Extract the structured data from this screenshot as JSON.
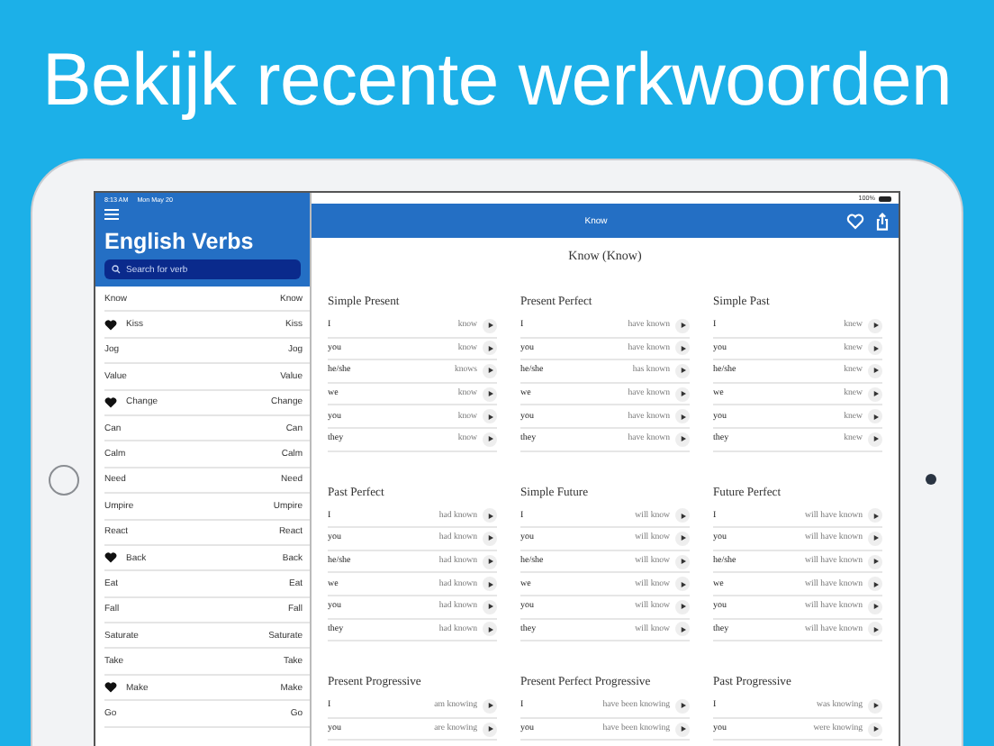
{
  "headline": "Bekijk recente werkwoorden",
  "status_bar": {
    "time": "8:13 AM",
    "date": "Mon May 20",
    "battery": "100%"
  },
  "sidebar": {
    "title": "English Verbs",
    "search": {
      "placeholder": "Search for verb"
    },
    "items": [
      {
        "left": "Know",
        "right": "Know",
        "favorite": false
      },
      {
        "left": "Kiss",
        "right": "Kiss",
        "favorite": true
      },
      {
        "left": "Jog",
        "right": "Jog",
        "favorite": false
      },
      {
        "left": "Value",
        "right": "Value",
        "favorite": false
      },
      {
        "left": "Change",
        "right": "Change",
        "favorite": true
      },
      {
        "left": "Can",
        "right": "Can",
        "favorite": false
      },
      {
        "left": "Calm",
        "right": "Calm",
        "favorite": false
      },
      {
        "left": "Need",
        "right": "Need",
        "favorite": false
      },
      {
        "left": "Umpire",
        "right": "Umpire",
        "favorite": false
      },
      {
        "left": "React",
        "right": "React",
        "favorite": false
      },
      {
        "left": "Back",
        "right": "Back",
        "favorite": true
      },
      {
        "left": "Eat",
        "right": "Eat",
        "favorite": false
      },
      {
        "left": "Fall",
        "right": "Fall",
        "favorite": false
      },
      {
        "left": "Saturate",
        "right": "Saturate",
        "favorite": false
      },
      {
        "left": "Take",
        "right": "Take",
        "favorite": false
      },
      {
        "left": "Make",
        "right": "Make",
        "favorite": true
      },
      {
        "left": "Go",
        "right": "Go",
        "favorite": false
      }
    ]
  },
  "nav_bar": {
    "title": "Know"
  },
  "verb_title": "Know (Know)",
  "tenses": [
    {
      "name": "Simple Present",
      "rows": [
        {
          "pronoun": "I",
          "form": "know"
        },
        {
          "pronoun": "you",
          "form": "know"
        },
        {
          "pronoun": "he/she",
          "form": "knows"
        },
        {
          "pronoun": "we",
          "form": "know"
        },
        {
          "pronoun": "you",
          "form": "know"
        },
        {
          "pronoun": "they",
          "form": "know"
        }
      ]
    },
    {
      "name": "Present Perfect",
      "rows": [
        {
          "pronoun": "I",
          "form": "have known"
        },
        {
          "pronoun": "you",
          "form": "have known"
        },
        {
          "pronoun": "he/she",
          "form": "has known"
        },
        {
          "pronoun": "we",
          "form": "have known"
        },
        {
          "pronoun": "you",
          "form": "have known"
        },
        {
          "pronoun": "they",
          "form": "have known"
        }
      ]
    },
    {
      "name": "Simple Past",
      "rows": [
        {
          "pronoun": "I",
          "form": "knew"
        },
        {
          "pronoun": "you",
          "form": "knew"
        },
        {
          "pronoun": "he/she",
          "form": "knew"
        },
        {
          "pronoun": "we",
          "form": "knew"
        },
        {
          "pronoun": "you",
          "form": "knew"
        },
        {
          "pronoun": "they",
          "form": "knew"
        }
      ]
    },
    {
      "name": "Past Perfect",
      "rows": [
        {
          "pronoun": "I",
          "form": "had known"
        },
        {
          "pronoun": "you",
          "form": "had known"
        },
        {
          "pronoun": "he/she",
          "form": "had known"
        },
        {
          "pronoun": "we",
          "form": "had known"
        },
        {
          "pronoun": "you",
          "form": "had known"
        },
        {
          "pronoun": "they",
          "form": "had known"
        }
      ]
    },
    {
      "name": "Simple Future",
      "rows": [
        {
          "pronoun": "I",
          "form": "will know"
        },
        {
          "pronoun": "you",
          "form": "will know"
        },
        {
          "pronoun": "he/she",
          "form": "will know"
        },
        {
          "pronoun": "we",
          "form": "will know"
        },
        {
          "pronoun": "you",
          "form": "will know"
        },
        {
          "pronoun": "they",
          "form": "will know"
        }
      ]
    },
    {
      "name": "Future Perfect",
      "rows": [
        {
          "pronoun": "I",
          "form": "will have known"
        },
        {
          "pronoun": "you",
          "form": "will have known"
        },
        {
          "pronoun": "he/she",
          "form": "will have known"
        },
        {
          "pronoun": "we",
          "form": "will have known"
        },
        {
          "pronoun": "you",
          "form": "will have known"
        },
        {
          "pronoun": "they",
          "form": "will have known"
        }
      ]
    },
    {
      "name": "Present Progressive",
      "rows": [
        {
          "pronoun": "I",
          "form": "am knowing"
        },
        {
          "pronoun": "you",
          "form": "are knowing"
        }
      ]
    },
    {
      "name": "Present Perfect Progressive",
      "rows": [
        {
          "pronoun": "I",
          "form": "have been knowing"
        },
        {
          "pronoun": "you",
          "form": "have been knowing"
        }
      ]
    },
    {
      "name": "Past Progressive",
      "rows": [
        {
          "pronoun": "I",
          "form": "was knowing"
        },
        {
          "pronoun": "you",
          "form": "were knowing"
        }
      ]
    }
  ]
}
